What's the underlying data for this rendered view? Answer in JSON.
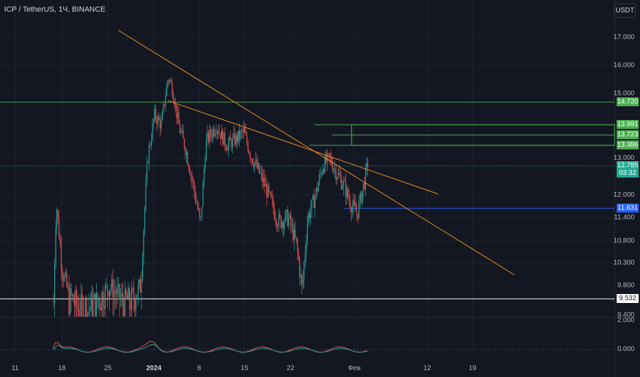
{
  "header": {
    "symbol_title": "ICP / TetherUS, 1Ч, BINANCE",
    "currency": "USDT"
  },
  "price_scale": {
    "labels": [
      {
        "value": 17.0,
        "text": "17.000"
      },
      {
        "value": 16.0,
        "text": "16.000"
      },
      {
        "value": 15.0,
        "text": "15.000"
      },
      {
        "value": 13.0,
        "text": "13.000"
      },
      {
        "value": 12.0,
        "text": "12.000"
      },
      {
        "value": 11.4,
        "text": "11.400"
      },
      {
        "value": 10.8,
        "text": "10.800"
      },
      {
        "value": 10.3,
        "text": "10.300"
      },
      {
        "value": 9.8,
        "text": "9.800"
      },
      {
        "value": 9.4,
        "text": "9.400"
      }
    ],
    "badges": [
      {
        "value": 14.72,
        "text": "14.720",
        "bg": "#4caf50",
        "fg": "#ffffff"
      },
      {
        "value": 13.991,
        "text": "13.991",
        "bg": "#4caf50",
        "fg": "#ffffff"
      },
      {
        "value": 13.723,
        "text": "13.723",
        "bg": "#4caf50",
        "fg": "#ffffff"
      },
      {
        "value": 13.386,
        "text": "13.386",
        "bg": "#4caf50",
        "fg": "#ffffff"
      },
      {
        "value": 12.785,
        "text": "12.785",
        "bg": "#22ab94",
        "fg": "#ffffff",
        "sub": "03:32"
      },
      {
        "value": 11.631,
        "text": "11.631",
        "bg": "#2962ff",
        "fg": "#ffffff"
      },
      {
        "value": 9.532,
        "text": "9.532",
        "bg": "#ffffff",
        "fg": "#131722"
      }
    ]
  },
  "oscillator_scale": [
    {
      "value": 2.0,
      "text": "2.000"
    },
    {
      "value": 0.0,
      "text": "0.000"
    }
  ],
  "time_axis": [
    {
      "text": "11",
      "bold": false
    },
    {
      "text": "18",
      "bold": false
    },
    {
      "text": "25",
      "bold": false
    },
    {
      "text": "2024",
      "bold": true
    },
    {
      "text": "8",
      "bold": false
    },
    {
      "text": "15",
      "bold": false
    },
    {
      "text": "22",
      "bold": false
    },
    {
      "text": "Фев",
      "bold": false
    },
    {
      "text": "12",
      "bold": false
    },
    {
      "text": "19",
      "bold": false
    }
  ],
  "colors": {
    "up": "#26a69a",
    "down": "#ef5350",
    "trendline": "#f7931a",
    "zone": "#4caf50",
    "support": "#2962ff",
    "white_line": "#ffffff",
    "grid": "#1f2330"
  }
}
